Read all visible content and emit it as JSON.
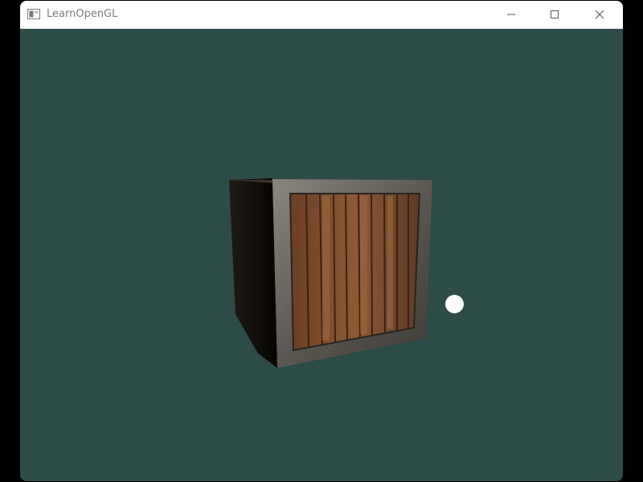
{
  "window": {
    "title": "LearnOpenGL",
    "app_icon": "app-window-icon",
    "controls": {
      "minimize_icon": "minimize-icon",
      "maximize_icon": "maximize-icon",
      "close_icon": "close-icon"
    }
  },
  "scene": {
    "clear_color": "#2d4b47",
    "crate_wood_color": "#7a4a2c",
    "crate_frame_color": "#6c6a66",
    "light_color": "#ffffff"
  }
}
